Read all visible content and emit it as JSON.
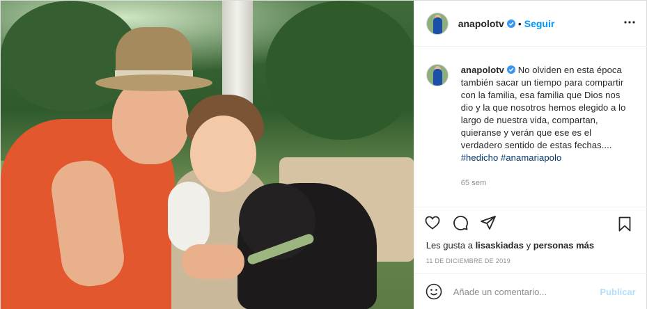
{
  "post": {
    "username": "anapolotv",
    "follow_label": "Seguir",
    "separator": "•",
    "caption_text": "No olviden en esta época también sacar un tiempo para compartir con la familia, esa familia que Dios nos dio y la que nosotros hemos elegido a lo largo de nuestra vida, compartan, quieranse y verán que ese es el verdadero sentido de estas fechas....",
    "hashtags": [
      "#hedicho",
      "#anamariapolo"
    ],
    "time_ago": "65 sem",
    "likes_prefix": "Les gusta a",
    "likes_user": "lisaskiadas",
    "likes_conjunction": "y",
    "likes_others": "personas más",
    "date": "11 DE DICIEMBRE DE 2019",
    "comment_placeholder": "Añade un comentario...",
    "publish_label": "Publicar"
  },
  "icons": {
    "verified": "verified-badge-icon",
    "more": "more-options-icon",
    "like": "heart-icon",
    "comment": "comment-bubble-icon",
    "share": "paper-plane-icon",
    "save": "bookmark-icon",
    "emoji": "emoji-smile-icon"
  },
  "colors": {
    "accent": "#0095f6",
    "verified": "#3897f0",
    "hashtag": "#00376b",
    "muted": "#8e8e8e",
    "publish_disabled": "#b2dffc"
  }
}
